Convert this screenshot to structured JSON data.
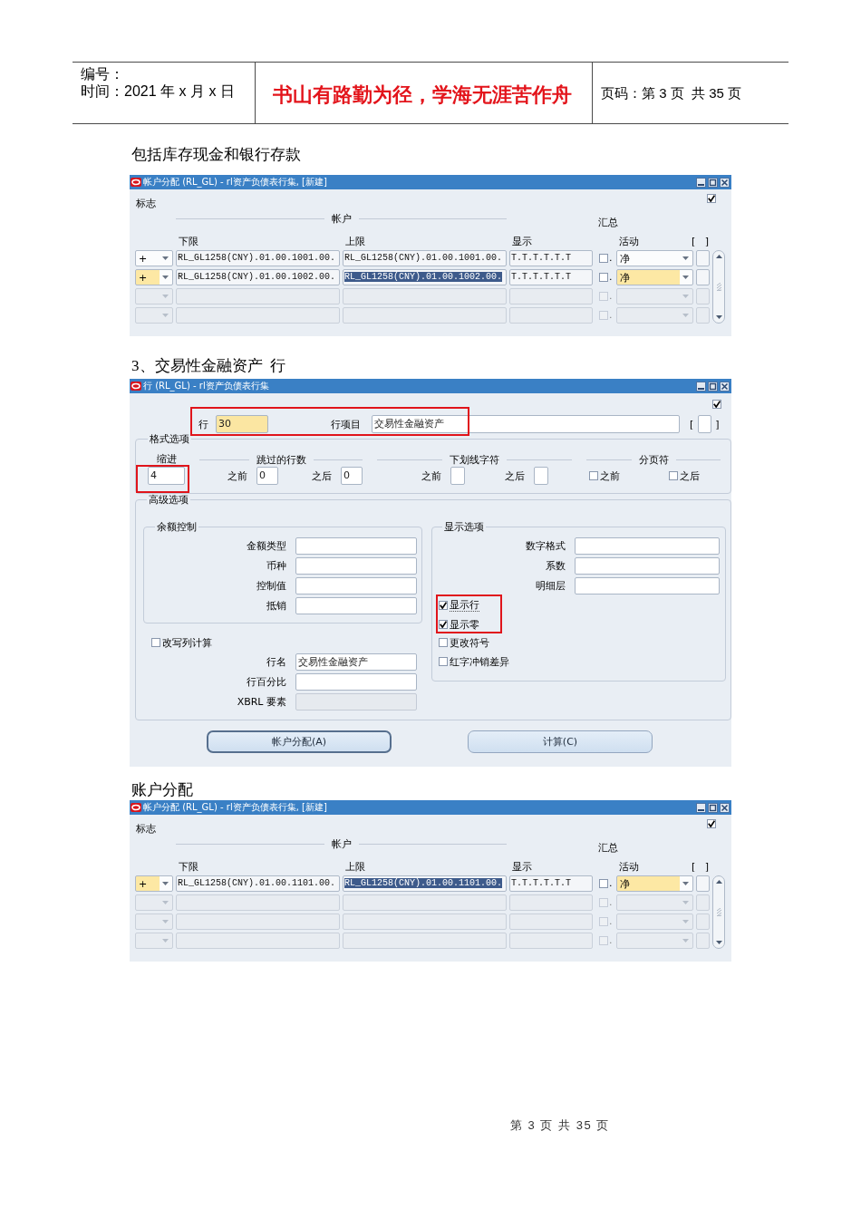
{
  "header": {
    "number_label": "编号：",
    "date": "时间：2021 年 x 月 x 日",
    "motto": "书山有路勤为径，学海无涯苦作舟",
    "page_info": "页码：第 3 页  共 35 页"
  },
  "blocks": [
    {
      "kind": "paragraph",
      "text": "包括库存现金和银行存款"
    },
    {
      "kind": "account_window",
      "title": "帐户分配 (RL_GL) - rl资产负债表行集, [新建]",
      "corner_checkbox": {
        "checked": true
      },
      "flag_label": "标志",
      "group_label": "帐户",
      "summary_label": "汇总",
      "columns": [
        "下限",
        "上限",
        "显示"
      ],
      "activity_label": "活动",
      "bracket_open": "[",
      "bracket_close": "]",
      "rows": [
        {
          "sign": "+",
          "low": "RL_GL1258(CNY).01.00.1001.00.",
          "high": "RL_GL1258(CNY).01.00.1001.00.",
          "display": "T.T.T.T.T.T",
          "checked": false,
          "dot": ".",
          "activity": "净",
          "selected": false,
          "disabled": false
        },
        {
          "sign": "+",
          "low": "RL_GL1258(CNY).01.00.1002.00.",
          "high": "RL_GL1258(CNY).01.00.1002.00.",
          "display": "T.T.T.T.T.T",
          "checked": false,
          "dot": ".",
          "activity": "净",
          "selected": true,
          "disabled": false
        },
        {
          "checked": false,
          "dot": ".",
          "selected": false,
          "disabled": true
        },
        {
          "checked": false,
          "dot": ".",
          "selected": false,
          "disabled": true
        }
      ]
    },
    {
      "kind": "paragraph",
      "text": "3、交易性金融资产  行"
    },
    {
      "kind": "line_window",
      "title": "行 (RL_GL) - rl资产负债表行集",
      "corner_checkbox": {
        "checked": true
      },
      "line_fields": {
        "highlighted": true,
        "items": [
          {
            "label": "行",
            "value": "30",
            "current": true
          },
          {
            "label": "行项目",
            "value": "交易性金融资产",
            "current": false
          }
        ]
      },
      "bracket_open": "[",
      "bracket_close": "]",
      "format_options": {
        "title": "格式选项",
        "indent": {
          "label": "缩进",
          "value": "4",
          "highlighted": true
        },
        "skip_lines": {
          "title": "跳过的行数",
          "before_label": "之前",
          "before": "0",
          "after_label": "之后",
          "after": "0"
        },
        "underline": {
          "title": "下划线字符",
          "before_label": "之前",
          "after_label": "之后"
        },
        "page_break": {
          "title": "分页符",
          "before_label": "之前",
          "before_checked": false,
          "after_label": "之后",
          "after_checked": false
        }
      },
      "advanced": {
        "title": "高级选项",
        "balance_control": {
          "title": "余额控制",
          "fields": [
            {
              "label": "金额类型"
            },
            {
              "label": "币种"
            },
            {
              "label": "控制值"
            },
            {
              "label": "抵销"
            }
          ]
        },
        "override_column": {
          "label": "改写列计算",
          "checked": false
        },
        "line_fields": [
          {
            "label": "行名",
            "value": "交易性金融资产",
            "disabled": false
          },
          {
            "label": "行百分比",
            "disabled": false
          },
          {
            "label": "XBRL 要素",
            "disabled": true
          }
        ],
        "display_options": {
          "title": "显示选项",
          "fields": [
            {
              "label": "数字格式"
            },
            {
              "label": "系数"
            },
            {
              "label": "明细层"
            }
          ],
          "check_groups": [
            {
              "highlighted": true,
              "items": [
                {
                  "label": "显示行",
                  "checked": true,
                  "focused": true
                },
                {
                  "label": "显示零",
                  "checked": true,
                  "focused": false
                }
              ]
            },
            {
              "highlighted": false,
              "items": [
                {
                  "label": "更改符号",
                  "checked": false,
                  "focused": false
                },
                {
                  "label": "红字冲销差异",
                  "checked": false,
                  "focused": false
                }
              ]
            }
          ]
        }
      },
      "buttons": [
        {
          "label": "帐户分配(A)",
          "default": true
        },
        {
          "label": "计算(C)",
          "default": false
        }
      ]
    },
    {
      "kind": "paragraph",
      "text": "账户分配"
    },
    {
      "kind": "account_window",
      "title": "帐户分配 (RL_GL) - rl资产负债表行集, [新建]",
      "corner_checkbox": {
        "checked": true
      },
      "flag_label": "标志",
      "group_label": "帐户",
      "summary_label": "汇总",
      "columns": [
        "下限",
        "上限",
        "显示"
      ],
      "activity_label": "活动",
      "bracket_open": "[",
      "bracket_close": "]",
      "rows": [
        {
          "sign": "+",
          "low": "RL_GL1258(CNY).01.00.1101.00.",
          "high": "RL_GL1258(CNY).01.00.1101.00.",
          "display": "T.T.T.T.T.T",
          "checked": false,
          "dot": ".",
          "activity": "净",
          "selected": true,
          "disabled": false
        },
        {
          "checked": false,
          "dot": ".",
          "selected": false,
          "disabled": true
        },
        {
          "checked": false,
          "dot": ".",
          "selected": false,
          "disabled": true
        },
        {
          "checked": false,
          "dot": ".",
          "selected": false,
          "disabled": true
        }
      ]
    }
  ],
  "footer": "第 3 页 共 35 页"
}
